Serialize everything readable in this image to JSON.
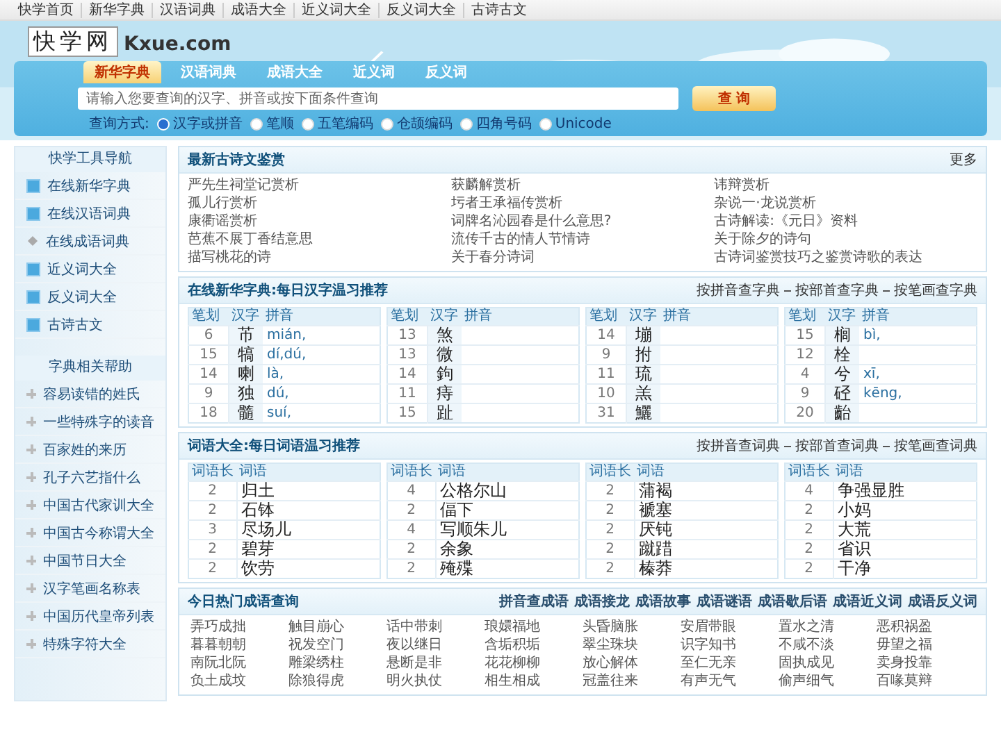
{
  "top_nav": [
    "快学首页",
    "新华字典",
    "汉语词典",
    "成语大全",
    "近义词大全",
    "反义词大全",
    "古诗古文"
  ],
  "logo": {
    "name": "快学网",
    "domain": "Kxue.com"
  },
  "search": {
    "tabs": [
      {
        "label": "新华字典",
        "selected": true
      },
      {
        "label": "汉语词典",
        "selected": false
      },
      {
        "label": "成语大全",
        "selected": false
      },
      {
        "label": "近义词",
        "selected": false
      },
      {
        "label": "反义词",
        "selected": false
      }
    ],
    "placeholder": "请输入您要查询的汉字、拼音或按下面条件查询",
    "button": "查 询",
    "mode_label": "查询方式:",
    "modes": [
      {
        "label": "汉字或拼音",
        "selected": true
      },
      {
        "label": "笔顺",
        "selected": false
      },
      {
        "label": "五笔编码",
        "selected": false
      },
      {
        "label": "仓颉编码",
        "selected": false
      },
      {
        "label": "四角号码",
        "selected": false
      },
      {
        "label": "Unicode",
        "selected": false
      }
    ]
  },
  "sidebar": {
    "nav_title": "快学工具导航",
    "nav_items": [
      {
        "label": "在线新华字典",
        "kind": "square"
      },
      {
        "label": "在线汉语词典",
        "kind": "square"
      },
      {
        "label": "在线成语词典",
        "kind": "diamond"
      },
      {
        "label": "近义词大全",
        "kind": "square"
      },
      {
        "label": "反义词大全",
        "kind": "square"
      },
      {
        "label": "古诗古文",
        "kind": "square"
      }
    ],
    "help_title": "字典相关帮助",
    "help_items": [
      "容易读错的姓氏",
      "一些特殊字的读音",
      "百家姓的来历",
      "孔子六艺指什么",
      "中国古代家训大全",
      "中国古今称谓大全",
      "中国节日大全",
      "汉字笔画名称表",
      "中国历代皇帝列表",
      "特殊字符大全"
    ]
  },
  "poems": {
    "title": "最新古诗文鉴赏",
    "more": "更多",
    "items": [
      "严先生祠堂记赏析",
      "获麟解赏析",
      "讳辩赏析",
      "孤儿行赏析",
      "圬者王承福传赏析",
      "杂说一·龙说赏析",
      "康衢谣赏析",
      "词牌名沁园春是什么意思?",
      "古诗解读:《元日》资料",
      "芭蕉不展丁香结意思",
      "流传千古的情人节情诗",
      "关于除夕的诗句",
      "描写桃花的诗",
      "关于春分诗词",
      "古诗词鉴赏技巧之鉴赏诗歌的表达"
    ]
  },
  "characters": {
    "title": "在线新华字典:每日汉字温习推荐",
    "links": [
      "按拼音查字典",
      "按部首查字典",
      "按笔画查字典"
    ],
    "groups": [
      {
        "headers": [
          "笔划",
          "汉字",
          "拼音"
        ],
        "rows": [
          {
            "strokes": "6",
            "char": "芇",
            "pinyin": "mián,"
          },
          {
            "strokes": "15",
            "char": "犒",
            "pinyin": "dí,dú,"
          },
          {
            "strokes": "14",
            "char": "喇",
            "pinyin": "là,"
          },
          {
            "strokes": "9",
            "char": "独",
            "pinyin": "dú,"
          },
          {
            "strokes": "18",
            "char": "髓",
            "pinyin": "suí,"
          }
        ]
      },
      {
        "headers": [
          "笔划",
          "汉字",
          "拼音"
        ],
        "rows": [
          {
            "strokes": "13",
            "char": "煞",
            "pinyin": ""
          },
          {
            "strokes": "13",
            "char": "微",
            "pinyin": ""
          },
          {
            "strokes": "14",
            "char": "鉤",
            "pinyin": ""
          },
          {
            "strokes": "11",
            "char": "痔",
            "pinyin": ""
          },
          {
            "strokes": "15",
            "char": "趾",
            "pinyin": ""
          }
        ]
      },
      {
        "headers": [
          "笔划",
          "汉字",
          "拼音"
        ],
        "rows": [
          {
            "strokes": "14",
            "char": "塴",
            "pinyin": ""
          },
          {
            "strokes": "9",
            "char": "拊",
            "pinyin": ""
          },
          {
            "strokes": "11",
            "char": "琉",
            "pinyin": ""
          },
          {
            "strokes": "10",
            "char": "羔",
            "pinyin": ""
          },
          {
            "strokes": "31",
            "char": "鱺",
            "pinyin": ""
          }
        ]
      },
      {
        "headers": [
          "笔划",
          "汉字",
          "拼音"
        ],
        "rows": [
          {
            "strokes": "15",
            "char": "榈",
            "pinyin": "bì,"
          },
          {
            "strokes": "12",
            "char": "栓",
            "pinyin": ""
          },
          {
            "strokes": "4",
            "char": "兮",
            "pinyin": "xī,"
          },
          {
            "strokes": "9",
            "char": "硁",
            "pinyin": "kēng,"
          },
          {
            "strokes": "20",
            "char": "齝",
            "pinyin": ""
          }
        ]
      }
    ]
  },
  "words": {
    "title": "词语大全:每日词语温习推荐",
    "links": [
      "按拼音查词典",
      "按部首查词典",
      "按笔画查词典"
    ],
    "groups": [
      {
        "headers": [
          "词语长",
          "词语"
        ],
        "rows": [
          {
            "length": "2",
            "word": "归土"
          },
          {
            "length": "2",
            "word": "石钵"
          },
          {
            "length": "3",
            "word": "尽场儿"
          },
          {
            "length": "2",
            "word": "碧芽"
          },
          {
            "length": "2",
            "word": "饮劳"
          }
        ]
      },
      {
        "headers": [
          "词语长",
          "词语"
        ],
        "rows": [
          {
            "length": "4",
            "word": "公格尔山"
          },
          {
            "length": "2",
            "word": "偪下"
          },
          {
            "length": "4",
            "word": "写顺朱儿"
          },
          {
            "length": "2",
            "word": "余象"
          },
          {
            "length": "2",
            "word": "殗殜"
          }
        ]
      },
      {
        "headers": [
          "词语长",
          "词语"
        ],
        "rows": [
          {
            "length": "2",
            "word": "蒲褐"
          },
          {
            "length": "2",
            "word": "褫塞"
          },
          {
            "length": "2",
            "word": "厌钝"
          },
          {
            "length": "2",
            "word": "蹴踖"
          },
          {
            "length": "2",
            "word": "榛莽"
          }
        ]
      },
      {
        "headers": [
          "词语长",
          "词语"
        ],
        "rows": [
          {
            "length": "4",
            "word": "争强显胜"
          },
          {
            "length": "2",
            "word": "小妈"
          },
          {
            "length": "2",
            "word": "大荒"
          },
          {
            "length": "2",
            "word": "省识"
          },
          {
            "length": "2",
            "word": "干净"
          }
        ]
      }
    ]
  },
  "idioms": {
    "title": "今日热门成语查询",
    "links": [
      "拼音查成语",
      "成语接龙",
      "成语故事",
      "成语谜语",
      "成语歇后语",
      "成语近义词",
      "成语反义词"
    ],
    "items": [
      "弄巧成拙",
      "触目崩心",
      "话中带刺",
      "琅嬛福地",
      "头昏脑胀",
      "安眉带眼",
      "置水之清",
      "恶积祸盈",
      "暮暮朝朝",
      "祝发空门",
      "夜以继日",
      "含垢积垢",
      "翠尘珠块",
      "识字知书",
      "不咸不淡",
      "毋望之福",
      "南阮北阮",
      "雕梁绣柱",
      "悬断是非",
      "花花柳柳",
      "放心解体",
      "至仁无亲",
      "固执成见",
      "卖身投靠",
      "负土成坟",
      "除狼得虎",
      "明火执仗",
      "相生相成",
      "冠盖往来",
      "有声无气",
      "偷声细气",
      "百喙莫辩"
    ]
  }
}
